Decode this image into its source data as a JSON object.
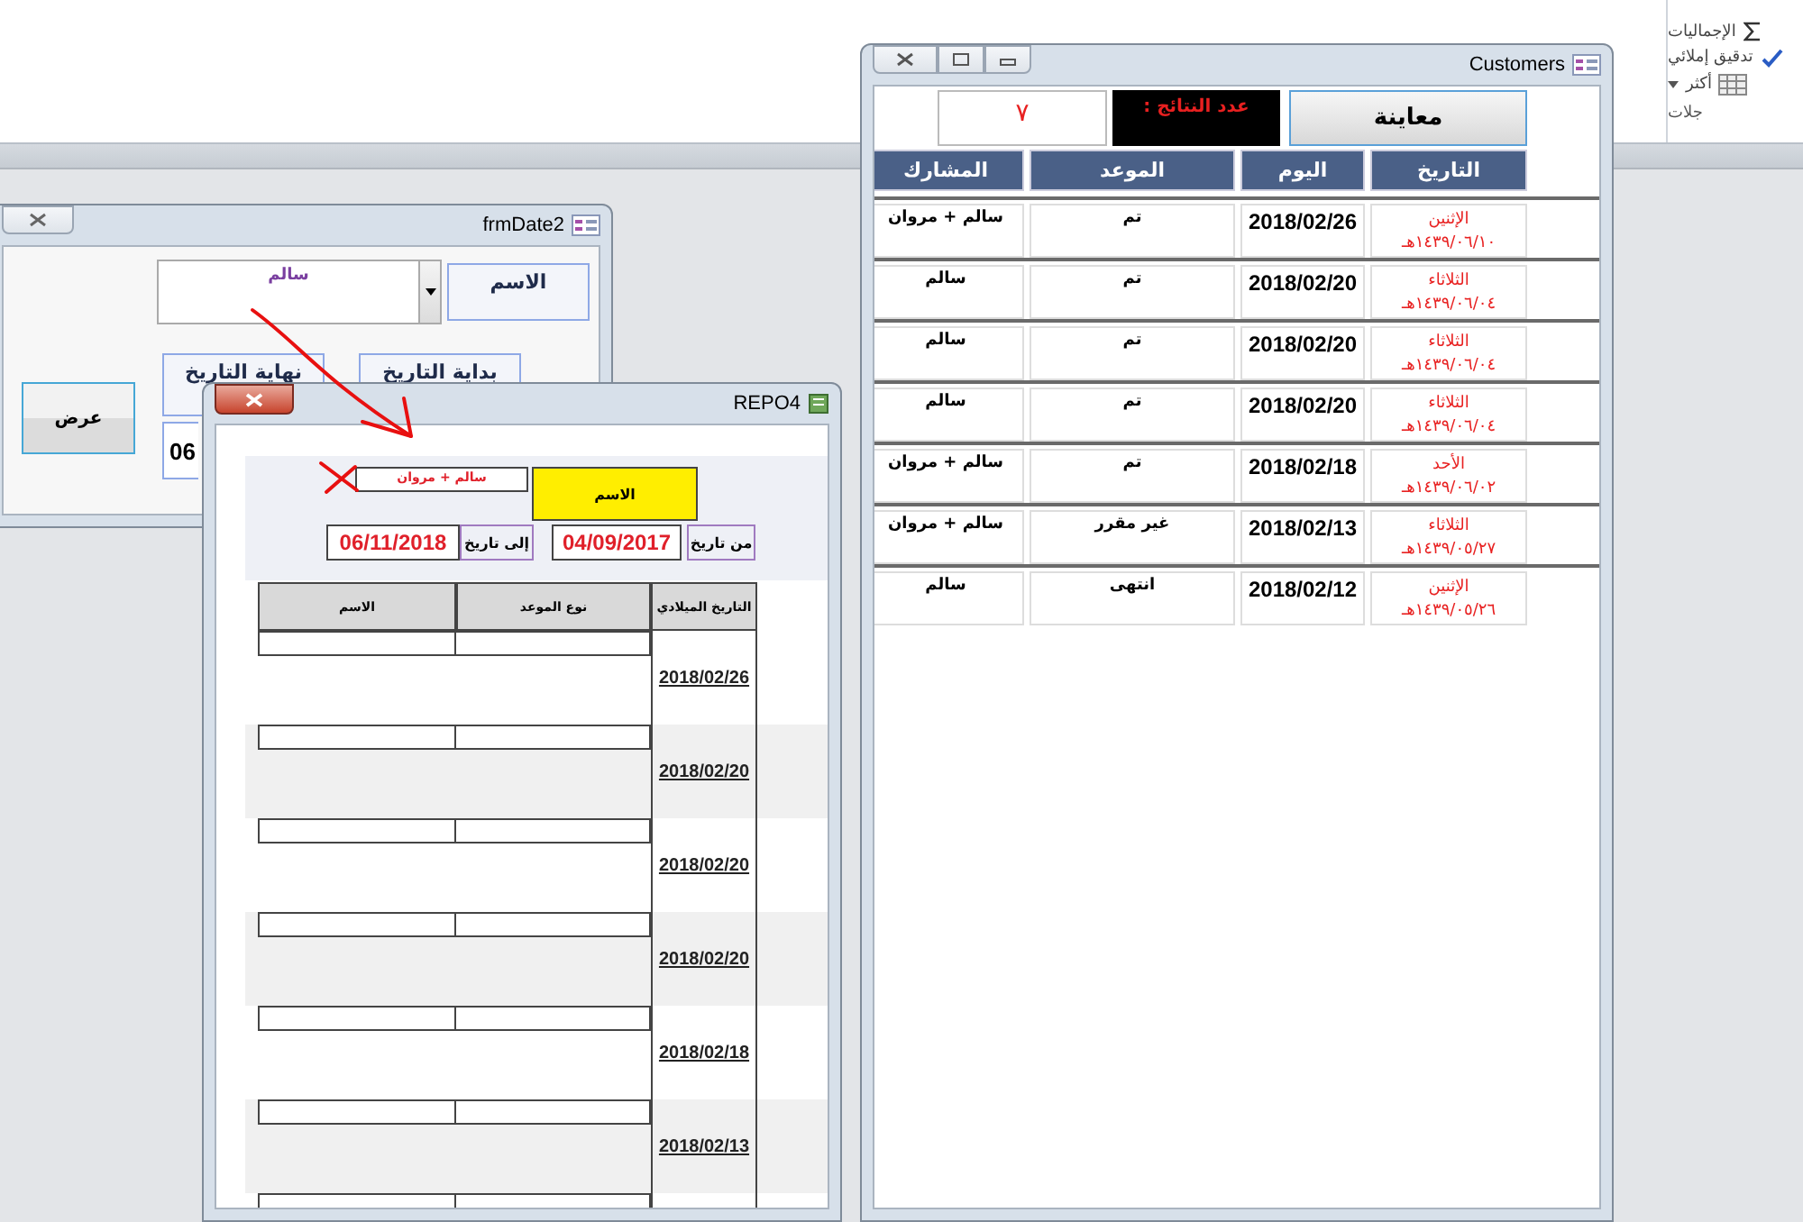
{
  "ribbon": {
    "commands": [
      {
        "label": "الإجماليات"
      },
      {
        "label": "تدقيق إملائي"
      },
      {
        "label": "أكثر"
      }
    ],
    "group_label": "جلات"
  },
  "frm_date2": {
    "title": "frmDate2",
    "name_label": "الاسم",
    "name_value": "سالم",
    "start_label": "بداية التاريخ",
    "end_label": "نهاية التاريخ",
    "end_value": "06",
    "show_button": "عرض"
  },
  "repo4": {
    "title": "REPO4",
    "name_label": "الاسم",
    "name_value": "سالم + مروان",
    "from_label": "من تاريخ",
    "from_value": "04/09/2017",
    "to_label": "إلى تاريخ",
    "to_value": "06/11/2018",
    "columns": [
      "التاريخ الميلادي",
      "نوع الموعد",
      "الاسم"
    ],
    "rows": [
      {
        "date": "2018/02/26"
      },
      {
        "date": "2018/02/20"
      },
      {
        "date": "2018/02/20"
      },
      {
        "date": "2018/02/20"
      },
      {
        "date": "2018/02/18"
      },
      {
        "date": "2018/02/13"
      }
    ]
  },
  "customers": {
    "title": "Customers",
    "preview_button": "معاينة",
    "result_label": "عدد النتائج :",
    "result_count": "٧",
    "columns": [
      "التاريخ",
      "اليوم",
      "الموعد",
      "المشارك"
    ],
    "rows": [
      {
        "day": "الإثنين",
        "hijri": "١٤٣٩/٠٦/١٠هـ",
        "date": "2018/02/26",
        "appointment": "تم",
        "participant": "سالم + مروان"
      },
      {
        "day": "الثلاثاء",
        "hijri": "١٤٣٩/٠٦/٠٤هـ",
        "date": "2018/02/20",
        "appointment": "تم",
        "participant": "سالم"
      },
      {
        "day": "الثلاثاء",
        "hijri": "١٤٣٩/٠٦/٠٤هـ",
        "date": "2018/02/20",
        "appointment": "تم",
        "participant": "سالم"
      },
      {
        "day": "الثلاثاء",
        "hijri": "١٤٣٩/٠٦/٠٤هـ",
        "date": "2018/02/20",
        "appointment": "تم",
        "participant": "سالم"
      },
      {
        "day": "الأحد",
        "hijri": "١٤٣٩/٠٦/٠٢هـ",
        "date": "2018/02/18",
        "appointment": "تم",
        "participant": "سالم + مروان"
      },
      {
        "day": "الثلاثاء",
        "hijri": "١٤٣٩/٠٥/٢٧هـ",
        "date": "2018/02/13",
        "appointment": "غير مقرر",
        "participant": "سالم + مروان"
      },
      {
        "day": "الإثنين",
        "hijri": "١٤٣٩/٠٥/٢٦هـ",
        "date": "2018/02/12",
        "appointment": "انتهى",
        "participant": "سالم"
      }
    ]
  }
}
